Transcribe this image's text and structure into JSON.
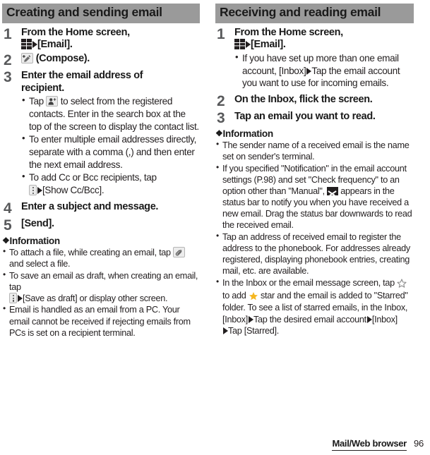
{
  "page": {
    "number": "96",
    "footer_label": "Mail/Web browser"
  },
  "left_column": {
    "section_title": "Creating and sending email",
    "steps": [
      {
        "number": "1",
        "title_line1": "From the Home screen,",
        "title_line2_suffix": "[Email].",
        "icons": [
          "app-drawer-grid-icon",
          "arrow-icon"
        ]
      },
      {
        "number": "2",
        "title_suffix": "(Compose).",
        "icons": [
          "compose-icon"
        ]
      },
      {
        "number": "3",
        "title_line1": "Enter the email address of",
        "title_line2": "recipient.",
        "bullets": [
          {
            "pre": "Tap",
            "icon": "add-contact-icon",
            "post": "to select from the registered contacts. Enter in the search box at the top of the screen to display the contact list."
          },
          {
            "text": "To enter multiple email addresses directly, separate with a comma (,) and then enter the next email address."
          },
          {
            "pre": "To add Cc or Bcc recipients, tap",
            "icon": "overflow-menu-icon",
            "post": "[Show Cc/Bcc]."
          }
        ]
      },
      {
        "number": "4",
        "title": "Enter a subject and message."
      },
      {
        "number": "5",
        "title": "[Send]."
      }
    ],
    "information": {
      "heading": "Information",
      "bullets": [
        {
          "pre": "To attach a file, while creating an email, tap",
          "icon": "attachment-icon",
          "post": "and select a file."
        },
        {
          "pre": "To save an email as draft, when creating an email, tap",
          "icon": "overflow-menu-icon",
          "post": "[Save as draft] or display other screen."
        },
        {
          "text": "Email is handled as an email from a PC. Your email cannot be received if rejecting emails from PCs is set on a recipient terminal."
        }
      ]
    }
  },
  "right_column": {
    "section_title": "Receiving and reading email",
    "steps": [
      {
        "number": "1",
        "title_line1": "From the Home screen,",
        "title_line2_suffix": "[Email].",
        "bullets": [
          {
            "text_a": "If you have set up more than one email account, [Inbox]",
            "text_b": "Tap the email account you want to use for incoming emails."
          }
        ]
      },
      {
        "number": "2",
        "title": "On the Inbox, flick the screen."
      },
      {
        "number": "3",
        "title": "Tap an email you want to read."
      }
    ],
    "information": {
      "heading": "Information",
      "bullets": [
        {
          "text": "The sender name of a received email is the name set on sender's terminal."
        },
        {
          "pre": "If you specified \"Notification\" in the email account settings (P.98) and set \"Check frequency\" to an option other than \"Manual\",",
          "icon": "envelope-icon",
          "post": "appears in the status bar to notify you when you have received a new email. Drag the status bar downwards to read the received email."
        },
        {
          "text": "Tap an address of received email to register the address to the phonebook. For addresses already registered, displaying phonebook entries, creating mail, etc. are available."
        },
        {
          "pre": "In the Inbox or the email message screen, tap",
          "icon": "star-outline-icon",
          "mid": "to add",
          "icon2": "star-filled-icon",
          "post": "star and the email is added to \"Starred\" folder. To see a list of starred emails, in the Inbox, [Inbox]",
          "post2": "Tap the desired email account",
          "post3": "[Inbox]",
          "post4": "Tap [Starred]."
        }
      ]
    }
  },
  "colors": {
    "header_bar": "#9a9a9a",
    "step_number": "#58595b",
    "text": "#231f20",
    "star_fill": "#f5b721"
  }
}
